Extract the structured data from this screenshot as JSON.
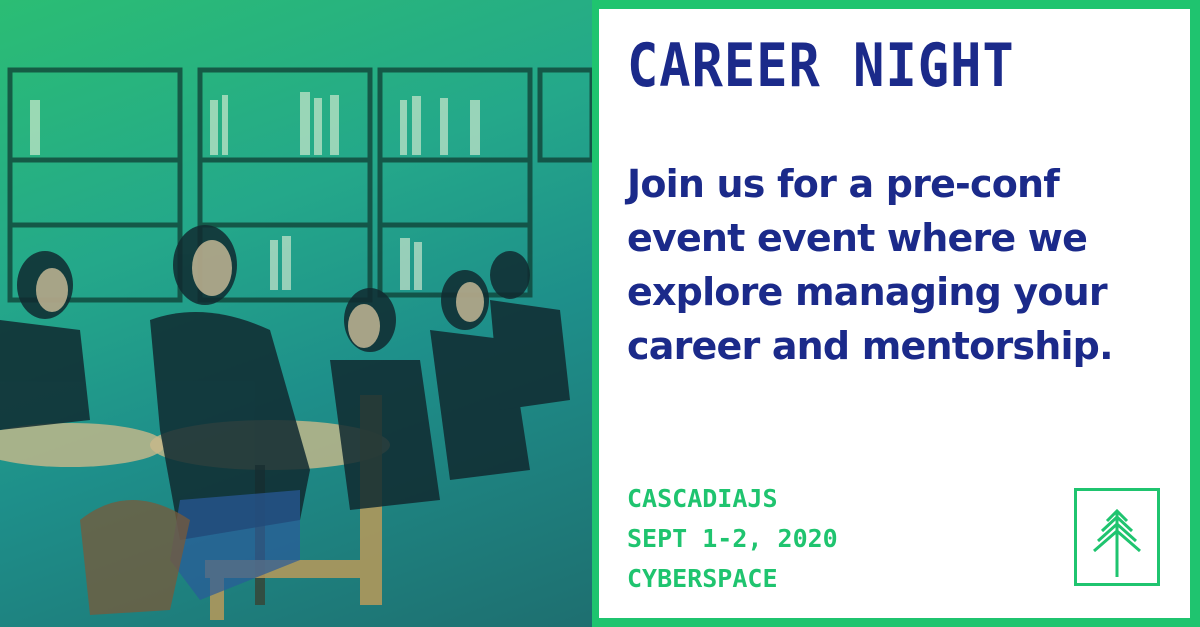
{
  "event": {
    "title": "CAREER NIGHT",
    "description": "Join us for a pre-conf event event where we explore managing your career and mentorship.",
    "details": [
      "CASCADIAJS",
      "SEPT 1-2, 2020",
      "CYBERSPACE"
    ]
  },
  "logo": {
    "icon": "tree-icon"
  },
  "photo": {
    "subject": "people-at-tables-icon"
  },
  "colors": {
    "accent_green": "#1fc46f",
    "text_navy": "#1b2a8a",
    "card_bg": "#ffffff"
  }
}
